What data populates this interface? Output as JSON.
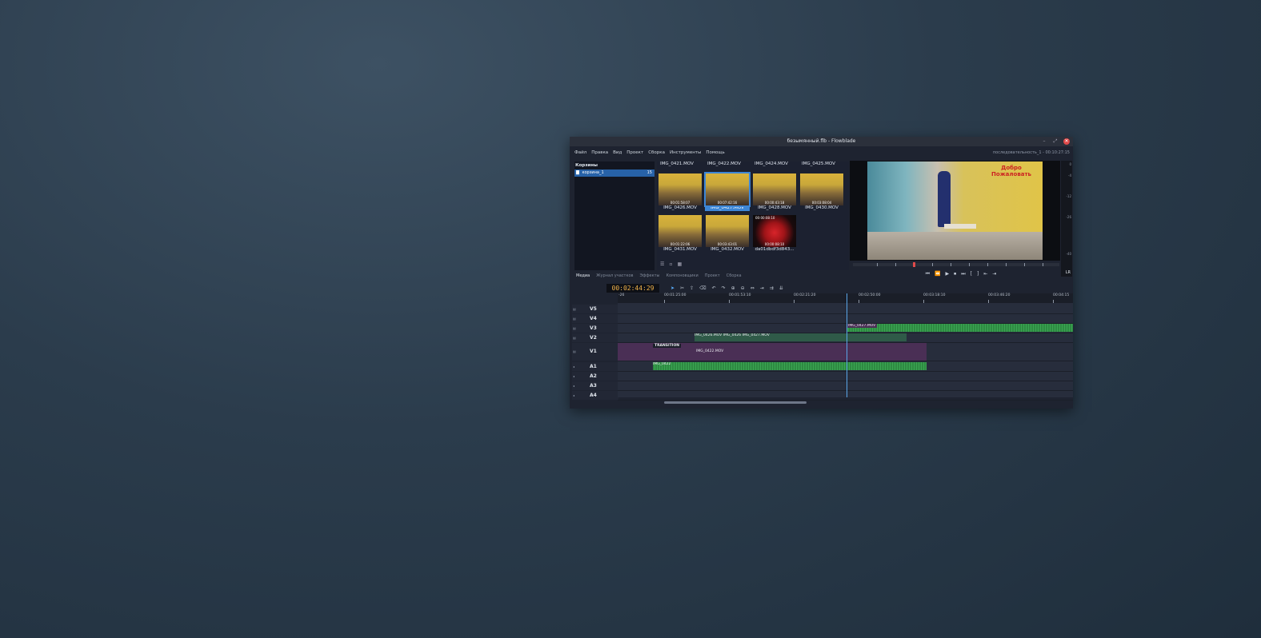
{
  "window": {
    "title": "безымянный.flb - Flowblade",
    "controls": {
      "minimize": "–",
      "maximize": "⤢",
      "close": "✕"
    }
  },
  "menu": {
    "items": [
      "Файл",
      "Правка",
      "Вид",
      "Проект",
      "Сборка",
      "Инструменты",
      "Помощь"
    ],
    "sequence_info": "последовательность_1 - 00:10:27:15"
  },
  "bins": {
    "header": "Корзины",
    "items": [
      {
        "name": "корзина_1",
        "count": "15"
      }
    ]
  },
  "media": {
    "top_row_names": [
      "IMG_0421.MOV",
      "IMG_0422.MOV",
      "IMG_0424.MOV",
      "IMG_0425.MOV"
    ],
    "clips": [
      {
        "name": "IMG_0426.MOV",
        "timecode": "00:01:58:07",
        "selected": false,
        "thumb": "stage"
      },
      {
        "name": "IMG_0427.MOV",
        "timecode": "00:07:42:16",
        "selected": true,
        "thumb": "stage"
      },
      {
        "name": "IMG_0428.MOV",
        "timecode": "00:00:43:18",
        "selected": false,
        "thumb": "stage"
      },
      {
        "name": "IMG_0430.MOV",
        "timecode": "00:03:08:04",
        "selected": false,
        "thumb": "stage"
      },
      {
        "name": "IMG_0431.MOV",
        "timecode": "00:01:22:06",
        "selected": false,
        "thumb": "stage"
      },
      {
        "name": "IMG_0432.MOV",
        "timecode": "00:03:43:01",
        "selected": false,
        "thumb": "stage"
      },
      {
        "name": "da01dbdf3d843...",
        "timecode": "00:00:08:10",
        "selected": false,
        "thumb": "rose",
        "badge": "00:00:08:10"
      }
    ]
  },
  "tabs": [
    "Медиа",
    "Журнал участков",
    "Эффекты",
    "Компоновщики",
    "Проект",
    "Сборка"
  ],
  "monitor": {
    "scene_sign": "Добро Пожаловать",
    "meter_ticks": [
      "0",
      "-4",
      "-12",
      "-26",
      "-40"
    ],
    "meter_label": "LR"
  },
  "transport": [
    "⏮",
    "⏪",
    "▶",
    "⏹",
    "⏭",
    "[",
    "]",
    "⇤",
    "⇥"
  ],
  "timeline": {
    "timecode": "00:02:44:29",
    "ruler_labels": [
      "-26",
      "00:01:25:00",
      "00:01:53:10",
      "00:02:21:20",
      "00:02:50:00",
      "00:03:18:10",
      "00:03:46:20",
      "00:04:15"
    ],
    "tracks": [
      "V5",
      "V4",
      "V3",
      "V2",
      "V1",
      "A1",
      "A2",
      "A3",
      "A4"
    ],
    "clips": {
      "v3": "IMG_0427.MOV",
      "v2": "IMG_0426.MOV IMG_0426 IMG_0427.MOV",
      "v1_title": "TRANSITION",
      "v1": "IMG_0422.MOV",
      "a1": "IMG_0422"
    }
  }
}
